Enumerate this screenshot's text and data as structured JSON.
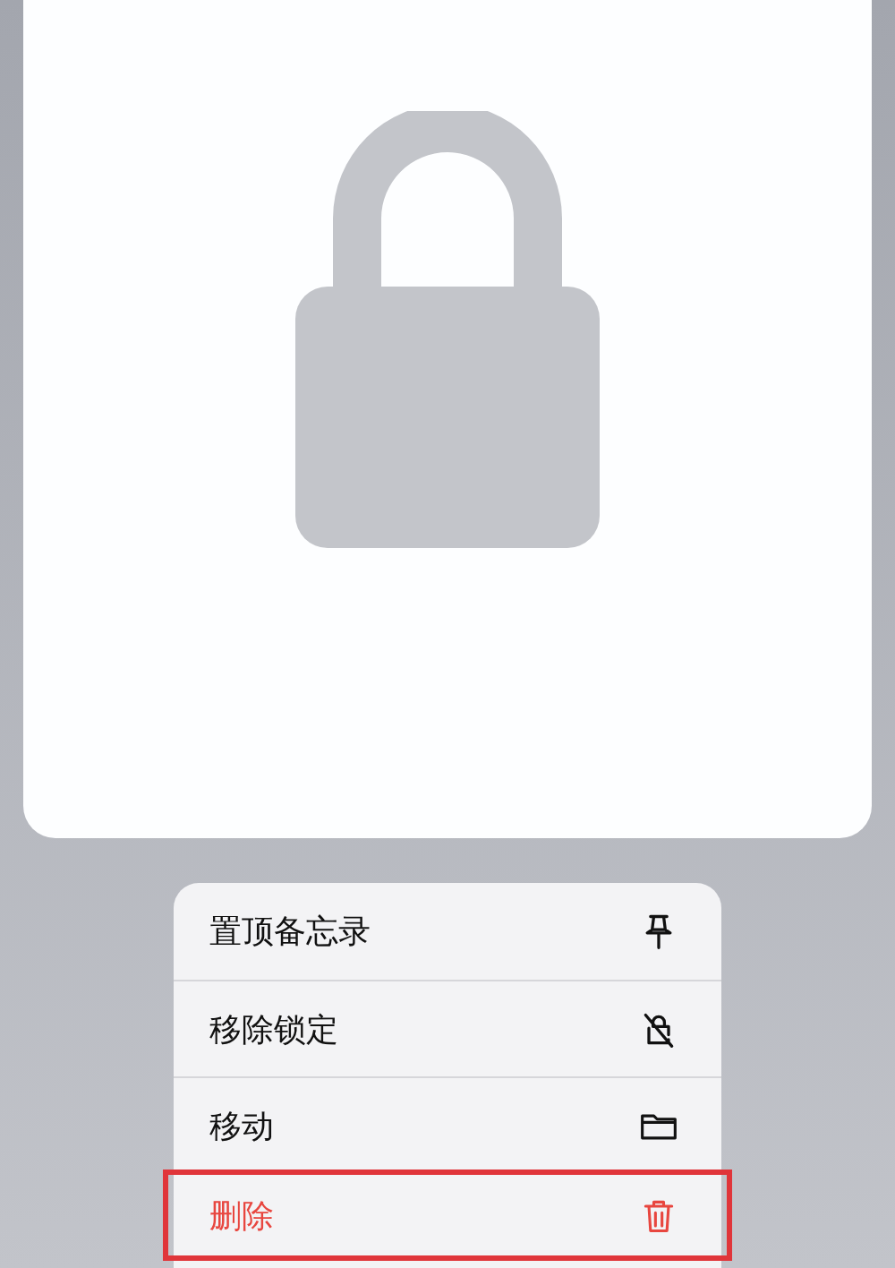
{
  "note_preview": {
    "locked": true
  },
  "menu": {
    "items": [
      {
        "label": "置顶备忘录",
        "kind": "normal",
        "highlighted": false
      },
      {
        "label": "移除锁定",
        "kind": "normal",
        "highlighted": false
      },
      {
        "label": "移动",
        "kind": "normal",
        "highlighted": false
      },
      {
        "label": "删除",
        "kind": "destructive",
        "highlighted": true
      }
    ]
  }
}
